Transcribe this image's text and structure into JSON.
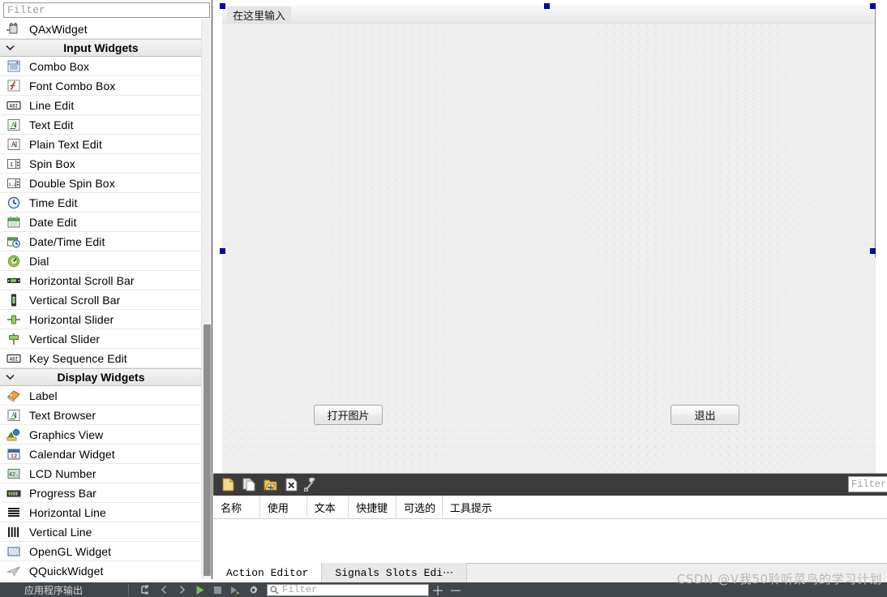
{
  "widget_box": {
    "filter_placeholder": "Filter",
    "rows": [
      {
        "type": "item",
        "label": "QAxWidget",
        "icon": "qaxwidget-icon"
      },
      {
        "type": "category",
        "label": "Input Widgets",
        "icon": "chevron-down-icon"
      },
      {
        "type": "item",
        "label": "Combo Box",
        "icon": "combobox-icon"
      },
      {
        "type": "item",
        "label": "Font Combo Box",
        "icon": "fontcombobox-icon"
      },
      {
        "type": "item",
        "label": "Line Edit",
        "icon": "lineedit-icon"
      },
      {
        "type": "item",
        "label": "Text Edit",
        "icon": "textedit-icon"
      },
      {
        "type": "item",
        "label": "Plain Text Edit",
        "icon": "plaintextedit-icon"
      },
      {
        "type": "item",
        "label": "Spin Box",
        "icon": "spinbox-icon"
      },
      {
        "type": "item",
        "label": "Double Spin Box",
        "icon": "doublespinbox-icon"
      },
      {
        "type": "item",
        "label": "Time Edit",
        "icon": "timeedit-icon"
      },
      {
        "type": "item",
        "label": "Date Edit",
        "icon": "dateedit-icon"
      },
      {
        "type": "item",
        "label": "Date/Time Edit",
        "icon": "datetimeedit-icon"
      },
      {
        "type": "item",
        "label": "Dial",
        "icon": "dial-icon"
      },
      {
        "type": "item",
        "label": "Horizontal Scroll Bar",
        "icon": "hscrollbar-icon"
      },
      {
        "type": "item",
        "label": "Vertical Scroll Bar",
        "icon": "vscrollbar-icon"
      },
      {
        "type": "item",
        "label": "Horizontal Slider",
        "icon": "hslider-icon"
      },
      {
        "type": "item",
        "label": "Vertical Slider",
        "icon": "vslider-icon"
      },
      {
        "type": "item",
        "label": "Key Sequence Edit",
        "icon": "keysequenceedit-icon"
      },
      {
        "type": "category",
        "label": "Display Widgets",
        "icon": "chevron-down-icon"
      },
      {
        "type": "item",
        "label": "Label",
        "icon": "label-icon"
      },
      {
        "type": "item",
        "label": "Text Browser",
        "icon": "textbrowser-icon"
      },
      {
        "type": "item",
        "label": "Graphics View",
        "icon": "graphicsview-icon"
      },
      {
        "type": "item",
        "label": "Calendar Widget",
        "icon": "calendar-icon"
      },
      {
        "type": "item",
        "label": "LCD Number",
        "icon": "lcdnumber-icon"
      },
      {
        "type": "item",
        "label": "Progress Bar",
        "icon": "progressbar-icon"
      },
      {
        "type": "item",
        "label": "Horizontal Line",
        "icon": "hline-icon"
      },
      {
        "type": "item",
        "label": "Vertical Line",
        "icon": "vline-icon"
      },
      {
        "type": "item",
        "label": "OpenGL Widget",
        "icon": "opengl-icon"
      },
      {
        "type": "item",
        "label": "QQuickWidget",
        "icon": "qquickwidget-icon"
      }
    ]
  },
  "form": {
    "menubar_placeholder": "在这里输入",
    "buttons": [
      {
        "name": "open-image-button",
        "label": "打开图片"
      },
      {
        "name": "exit-button",
        "label": "退出"
      }
    ]
  },
  "action_editor": {
    "toolbar_icons": [
      "new-action-icon",
      "copy-icon",
      "open-folder-icon",
      "delete-icon",
      "configure-icon"
    ],
    "filter_placeholder": "Filter",
    "columns": [
      "名称",
      "使用",
      "文本",
      "快捷键",
      "可选的",
      "工具提示"
    ],
    "rows": [],
    "tabs": [
      {
        "label": "Action Editor",
        "active": true
      },
      {
        "label": "Signals  Slots Edi⋯",
        "active": false
      }
    ]
  },
  "statusbar": {
    "title": "应用程序输出",
    "icons": [
      "filter-tree-icon",
      "prev-icon",
      "next-icon",
      "run-icon",
      "stop-icon",
      "step-icon",
      "settings-icon"
    ],
    "search_placeholder": "Filter",
    "zoom_in": "＋",
    "zoom_out": "－"
  },
  "watermark": "CSDN @V我50聆听菜鸟的学习计划",
  "colors": {
    "selection_handle": "#0000c8",
    "canvas": "#efefef",
    "toolbar_dark": "#3b3b3b",
    "statusbar": "#41464b"
  }
}
